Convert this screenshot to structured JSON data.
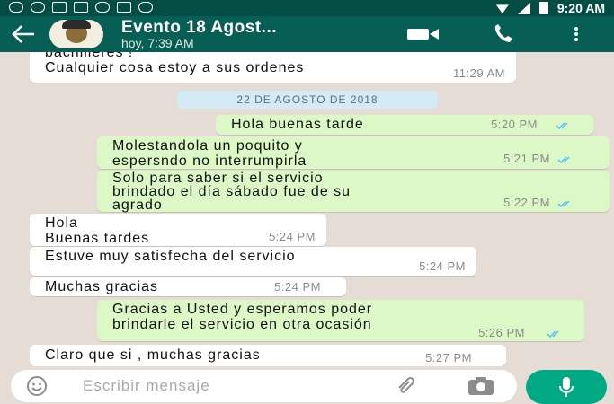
{
  "status_bar": {
    "time": "9:20 AM"
  },
  "header": {
    "contact_name": "Evento 18 Agost...",
    "contact_status": "hoy, 7:39 AM"
  },
  "chat": {
    "date_separator": "22 DE AGOSTO DE 2018",
    "messages": [
      {
        "direction": "in",
        "text": "bachilleres !\nCualquier cosa estoy a sus ordenes",
        "time": "11:29 AM"
      },
      {
        "direction": "out",
        "text": "Hola buenas tarde",
        "time": "5:20 PM",
        "read": true
      },
      {
        "direction": "out",
        "text": "Molestandola un poquito y\nespersndo no interrumpirla",
        "time": "5:21 PM",
        "read": true
      },
      {
        "direction": "out",
        "text": "Solo para saber si el servicio\nbrindado el día sábado fue de su\nagrado",
        "time": "5:22 PM",
        "read": true
      },
      {
        "direction": "in",
        "text": "Hola\nBuenas tardes",
        "time": "5:24 PM"
      },
      {
        "direction": "in",
        "text": "Estuve muy satisfecha del servicio",
        "time": "5:24 PM"
      },
      {
        "direction": "in",
        "text": "Muchas gracias",
        "time": "5:24 PM"
      },
      {
        "direction": "out",
        "text": "Gracias a Usted y esperamos poder\nbrindarle el servicio en otra ocasión",
        "time": "5:26 PM",
        "read": true
      },
      {
        "direction": "in",
        "text": "Claro que si , muchas gracias",
        "time": "5:27 PM"
      }
    ]
  },
  "composer": {
    "placeholder": "Escribir mensaje"
  },
  "icons": {
    "back": "arrow-left-icon",
    "video": "video-camera-icon",
    "call": "phone-icon",
    "menu": "more-vertical-icon",
    "emoji": "smiley-icon",
    "attach": "paperclip-icon",
    "camera": "camera-icon",
    "mic": "microphone-icon"
  },
  "colors": {
    "header": "#075e54",
    "outgoing_bubble": "#dcf8c6",
    "incoming_bubble": "#ffffff",
    "read_ticks": "#4fc3f7",
    "mic_button": "#00a884",
    "chat_background": "#e5ddd5"
  }
}
